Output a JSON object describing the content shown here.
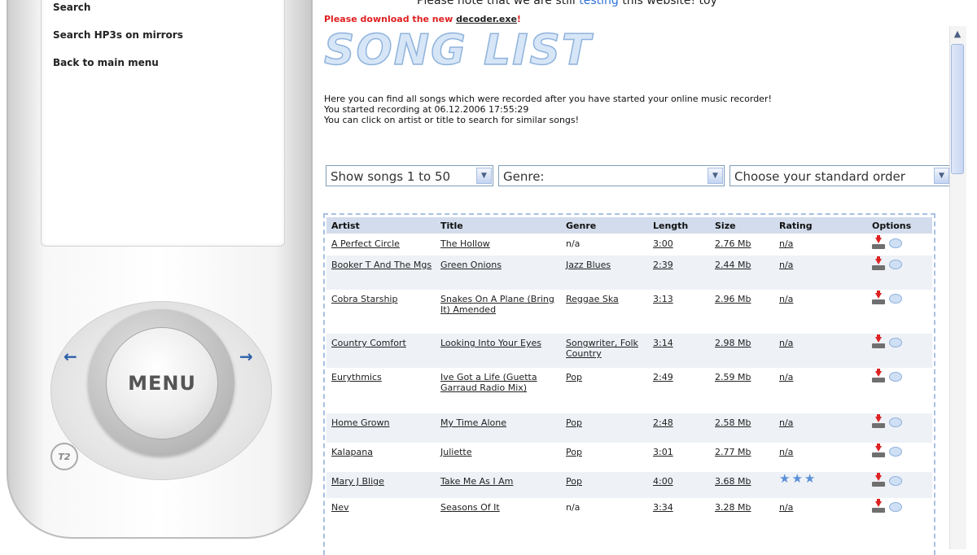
{
  "phone": {
    "menu_items": [
      "Search",
      "Search HP3s on mirrors",
      "Back to main menu"
    ],
    "menu_button_label": "MENU",
    "left_arrow": "←",
    "right_arrow": "→",
    "logo_text": "T2"
  },
  "notice": {
    "top_text_before": "Please note that we are still ",
    "top_text_link": "testing",
    "top_text_after": " this website! toy",
    "download_prefix": "Please download the new ",
    "download_link": "decoder.exe",
    "download_suffix": "!"
  },
  "song_list_title": "SONG LIST",
  "description": [
    "Here you can find all songs which were recorded after you have started your online music recorder!",
    "You started recording at 06.12.2006 17:55:29",
    "You can click on artist or title to search for similar songs!"
  ],
  "filters": {
    "show_songs": "Show songs 1 to 50",
    "genre": "Genre:",
    "order": "Choose your standard order"
  },
  "table": {
    "headers": [
      "Artist",
      "Title",
      "Genre",
      "Length",
      "Size",
      "Rating",
      "Options"
    ],
    "rows": [
      {
        "artist": "A Perfect Circle",
        "title": "The Hollow",
        "genre": "n/a",
        "length": "3:00",
        "size": "2.76 Mb",
        "rating": "n/a",
        "rating_stars": 0
      },
      {
        "artist": "Booker T And The Mgs",
        "title": "Green Onions",
        "genre": "Jazz Blues",
        "length": "2:39",
        "size": "2.44 Mb",
        "rating": "n/a",
        "rating_stars": 0
      },
      {
        "artist": "Cobra Starship",
        "title": "Snakes On A Plane (Bring It) Amended",
        "genre": "Reggae Ska",
        "length": "3:13",
        "size": "2.96 Mb",
        "rating": "n/a",
        "rating_stars": 0
      },
      {
        "artist": "Country Comfort",
        "title": "Looking Into Your Eyes",
        "genre": "Songwriter, Folk Country",
        "length": "3:14",
        "size": "2.98 Mb",
        "rating": "n/a",
        "rating_stars": 0
      },
      {
        "artist": "Eurythmics",
        "title": "Ive Got a Life (Guetta Garraud Radio Mix)",
        "genre": "Pop",
        "length": "2:49",
        "size": "2.59 Mb",
        "rating": "n/a",
        "rating_stars": 0
      },
      {
        "artist": "Home Grown",
        "title": "My Time Alone",
        "genre": "Pop",
        "length": "2:48",
        "size": "2.58 Mb",
        "rating": "n/a",
        "rating_stars": 0
      },
      {
        "artist": "Kalapana",
        "title": "Juliette",
        "genre": "Pop",
        "length": "3:01",
        "size": "2.77 Mb",
        "rating": "n/a",
        "rating_stars": 0
      },
      {
        "artist": "Mary J Blige",
        "title": "Take Me As I Am",
        "genre": "Pop",
        "length": "4:00",
        "size": "3.68 Mb",
        "rating": "",
        "rating_stars": 3
      },
      {
        "artist": "Nev",
        "title": "Seasons Of It",
        "genre": "n/a",
        "length": "3:34",
        "size": "3.28 Mb",
        "rating": "n/a",
        "rating_stars": 0
      }
    ]
  },
  "colors": {
    "accent_blue": "#2a6fd6",
    "download_red": "#e02020",
    "header_bg": "#d2dcec",
    "alt_row_bg": "#eef1f6",
    "table_border": "#a9c1e2"
  },
  "icons": [
    "download-icon",
    "comment-icon",
    "star-icon",
    "chevron-down-icon",
    "arrow-left-icon",
    "arrow-right-icon"
  ]
}
